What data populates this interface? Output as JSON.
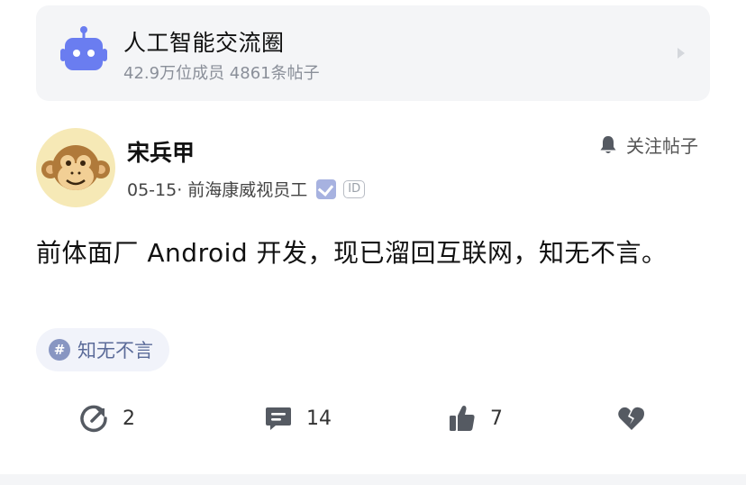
{
  "circle": {
    "name": "人工智能交流圈",
    "stats": "42.9万位成员 4861条帖子",
    "icon": "robot-icon"
  },
  "post": {
    "author": "宋兵甲",
    "meta": "05-15· 前海康威视员工",
    "id_badge": "ID",
    "follow_label": "关注帖子",
    "content": "前体面厂 Android 开发，现已溜回互联网，知无不言。",
    "topic": "知无不言"
  },
  "actions": {
    "share_count": "2",
    "comment_count": "14",
    "like_count": "7"
  },
  "colors": {
    "card_bg": "#f4f5f7",
    "icon_dark": "#555a62",
    "topic_bg": "#f1f3fa",
    "topic_text": "#5b6b99",
    "robot_blue": "#6a7df0"
  }
}
